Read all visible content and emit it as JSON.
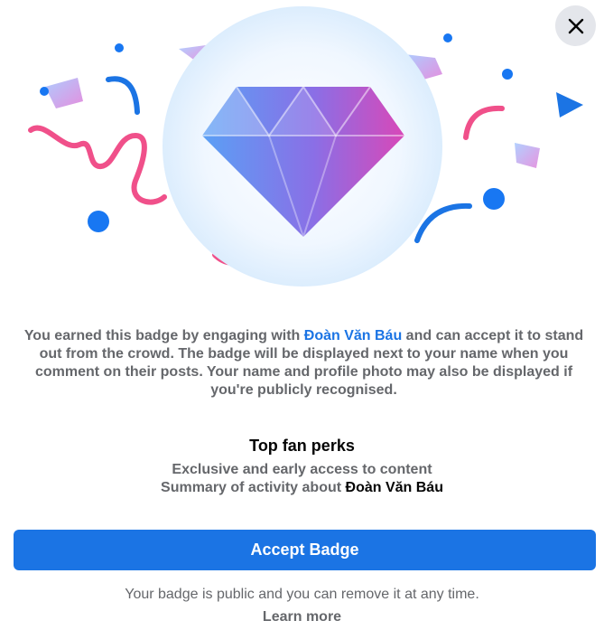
{
  "close": {
    "icon": "close-icon"
  },
  "hero": {
    "icon": "diamond-icon"
  },
  "description": {
    "before": "You earned this badge by engaging with ",
    "name": "Đoàn Văn Báu",
    "after": " and can accept it to stand out from the crowd. The badge will be displayed next to your name when you comment on their posts. Your name and profile photo may also be displayed if you're publicly recognised."
  },
  "perks": {
    "title": "Top fan perks",
    "items": [
      {
        "text": "Exclusive and early access to content"
      },
      {
        "text": "Summary of activity about ",
        "name": "Đoàn Văn Báu"
      }
    ]
  },
  "accept_label": "Accept Badge",
  "footnote": "Your badge is public and you can remove it at any time.",
  "learn_more": "Learn more",
  "colors": {
    "accent": "#1b74e4",
    "secondary_text": "#65676b",
    "primary_text": "#050505",
    "close_bg": "#e4e6eb"
  }
}
